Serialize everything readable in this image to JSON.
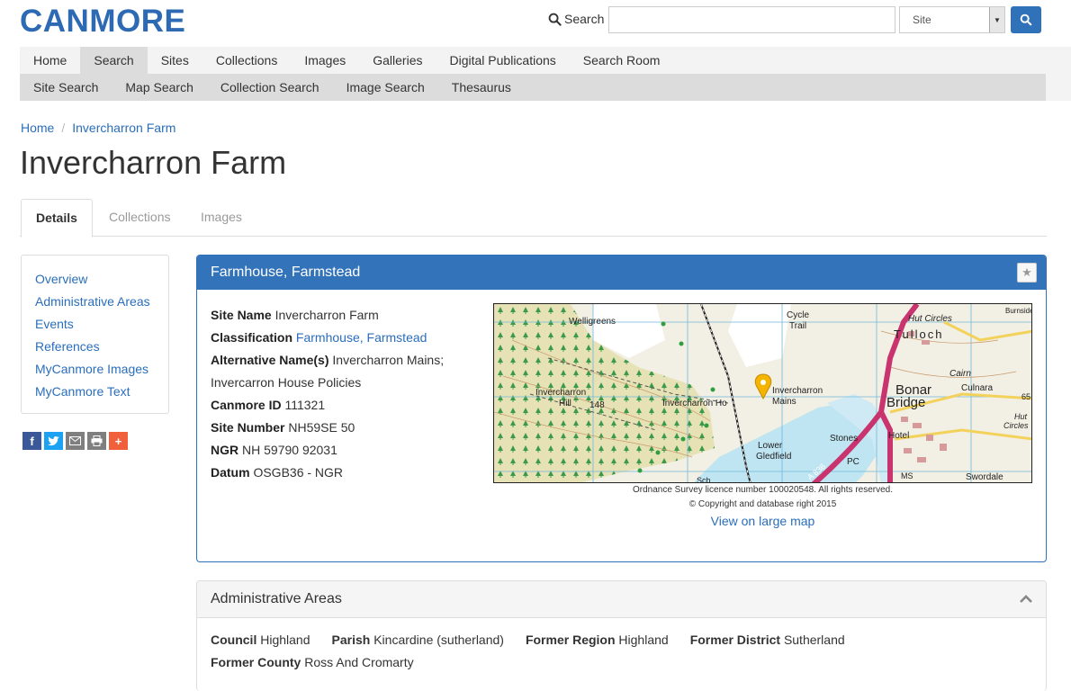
{
  "header": {
    "logo": "CANMORE",
    "search_label": "Search",
    "search_value": "",
    "select_value": "Site"
  },
  "main_nav": [
    "Home",
    "Search",
    "Sites",
    "Collections",
    "Images",
    "Galleries",
    "Digital Publications",
    "Search Room"
  ],
  "main_nav_active": "Search",
  "sub_nav": [
    "Site Search",
    "Map Search",
    "Collection Search",
    "Image Search",
    "Thesaurus"
  ],
  "breadcrumb": {
    "home": "Home",
    "separator": "/",
    "current": "Invercharron Farm"
  },
  "page_title": "Invercharron Farm",
  "tabs": [
    "Details",
    "Collections",
    "Images"
  ],
  "side_nav": [
    "Overview",
    "Administrative Areas",
    "Events",
    "References",
    "MyCanmore Images",
    "MyCanmore Text"
  ],
  "share_icons": [
    "facebook-icon",
    "twitter-icon",
    "email-icon",
    "print-icon",
    "add-icon"
  ],
  "panel": {
    "title": "Farmhouse, Farmstead",
    "site_name_label": "Site Name",
    "site_name": "Invercharron Farm",
    "classification_label": "Classification",
    "classification_1": "Farmhouse",
    "classification_sep": ", ",
    "classification_2": "Farmstead",
    "alt_names_label": "Alternative Name(s)",
    "alt_names": "Invercharron Mains; Invercarron House Policies",
    "canmore_id_label": "Canmore ID",
    "canmore_id": "111321",
    "site_number_label": "Site Number",
    "site_number": "NH59SE 50",
    "ngr_label": "NGR",
    "ngr": "NH 59790 92031",
    "datum_label": "Datum",
    "datum": "OSGB36 - NGR"
  },
  "map": {
    "labels": {
      "welligreens": "Welligreens",
      "cycle": "Cycle",
      "trail": "Trail",
      "hut_circles": "Hut Circles",
      "tulloch": "Tulloch",
      "cairn": "Cairn",
      "culnara": "Culnara",
      "bonar": "Bonar",
      "bridge": "Bridge",
      "invercharron_hill_1": "Invercharron",
      "invercharron_hill_2": "Hill",
      "spot_height": "148",
      "invercharron_ho": "Invercharron Ho",
      "invercharron_mains_1": "Invercharron",
      "invercharron_mains_2": "Mains",
      "lower_1": "Lower",
      "lower_2": "Gledfield",
      "stones": "Stones",
      "hotel": "Hotel",
      "road": "A 836",
      "pc": "PC",
      "ms": "MS",
      "swordale": "Swordale",
      "sch": "Sch",
      "hut_circles_2": "Hut",
      "circles_2": "Circles",
      "burnside": "Burnside",
      "number_65": "65"
    },
    "caption_licence": "Ordnance Survey licence number 100020548. All rights reserved.",
    "caption_copyright": "© Copyright and database right 2015",
    "large_map_link": "View on large map"
  },
  "admin": {
    "title": "Administrative Areas",
    "council_label": "Council",
    "council": "Highland",
    "parish_label": "Parish",
    "parish": "Kincardine (sutherland)",
    "former_region_label": "Former Region",
    "former_region": "Highland",
    "former_district_label": "Former District",
    "former_district": "Sutherland",
    "former_county_label": "Former County",
    "former_county": "Ross And Cromarty"
  },
  "colors": {
    "brand": "#2d6ab3",
    "panel_header": "#3373b9",
    "link": "#2a6ebb",
    "marker": "#f5b400"
  }
}
